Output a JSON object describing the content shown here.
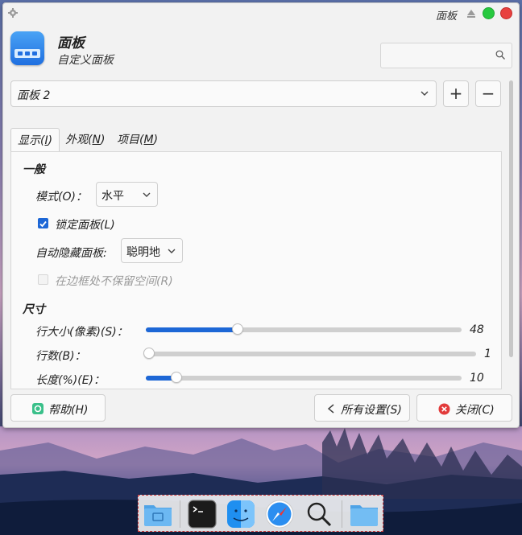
{
  "window": {
    "title": "面板",
    "controls": {
      "maximize_color": "#27c93f",
      "close_color": "#e8413f"
    }
  },
  "header": {
    "title": "面板",
    "subtitle": "自定义面板",
    "search_placeholder": ""
  },
  "panel_selector": {
    "value": "面板 2",
    "add_label": "+",
    "remove_label": "−"
  },
  "tabs": [
    {
      "label_pre": "显示(",
      "mnemonic": "I",
      "label_post": ")",
      "active": true
    },
    {
      "label_pre": "外观(",
      "mnemonic": "N",
      "label_post": ")",
      "active": false
    },
    {
      "label_pre": "项目(",
      "mnemonic": "M",
      "label_post": ")",
      "active": false
    }
  ],
  "general": {
    "heading": "一般",
    "mode_label": "模式(O)：",
    "mode_value": "水平",
    "lock_label": "锁定面板(L)",
    "lock_checked": true,
    "autohide_label": "自动隐藏面板:",
    "autohide_value": "聪明地",
    "reserve_label": "在边框处不保留空间(R)",
    "reserve_checked": false
  },
  "size": {
    "heading": "尺寸",
    "row_size_label": "行大小(像素)(S)：",
    "row_size_value": "48",
    "row_size_fraction": 0.29,
    "rows_label": "行数(B)：",
    "rows_value": "1",
    "rows_fraction": 0.0,
    "length_label": "长度(%)(E)：",
    "length_value": "10",
    "length_fraction": 0.09
  },
  "buttons": {
    "help": "帮助(H)",
    "all_settings": "所有设置(S)",
    "close": "关闭(C)"
  },
  "dock": {
    "items": [
      "file-manager-icon",
      "terminal-icon",
      "finder-icon",
      "safari-icon",
      "search-icon",
      "folder-icon"
    ]
  },
  "colors": {
    "accent": "#1d67d6"
  }
}
